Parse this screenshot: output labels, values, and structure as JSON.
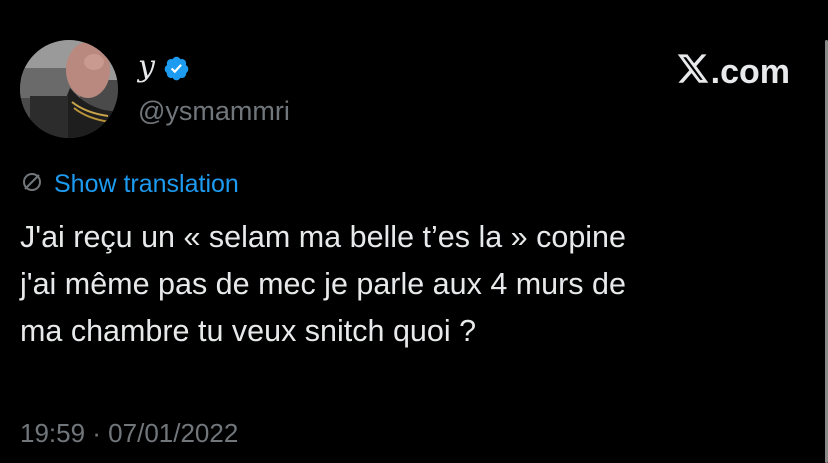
{
  "tweet": {
    "author": {
      "display_name": "y",
      "handle": "@ysmammri",
      "verified": true,
      "verified_color": "#1d9bf0",
      "avatar_icon": "profile-photo"
    },
    "brand": {
      "label": ".com",
      "icon": "x-logo-icon"
    },
    "translation": {
      "label": "Show translation",
      "icon": "translate-icon",
      "color": "#1d9bf0"
    },
    "text": "J'ai reçu un « selam ma belle t’es la » copine\nj'ai même pas de mec je parle aux 4 murs de\nma chambre tu veux snitch quoi ?",
    "timestamp": "19:59 · 07/01/2022"
  },
  "theme": {
    "background": "#000000",
    "text": "#e7e9ea",
    "secondary_text": "#71767b"
  }
}
